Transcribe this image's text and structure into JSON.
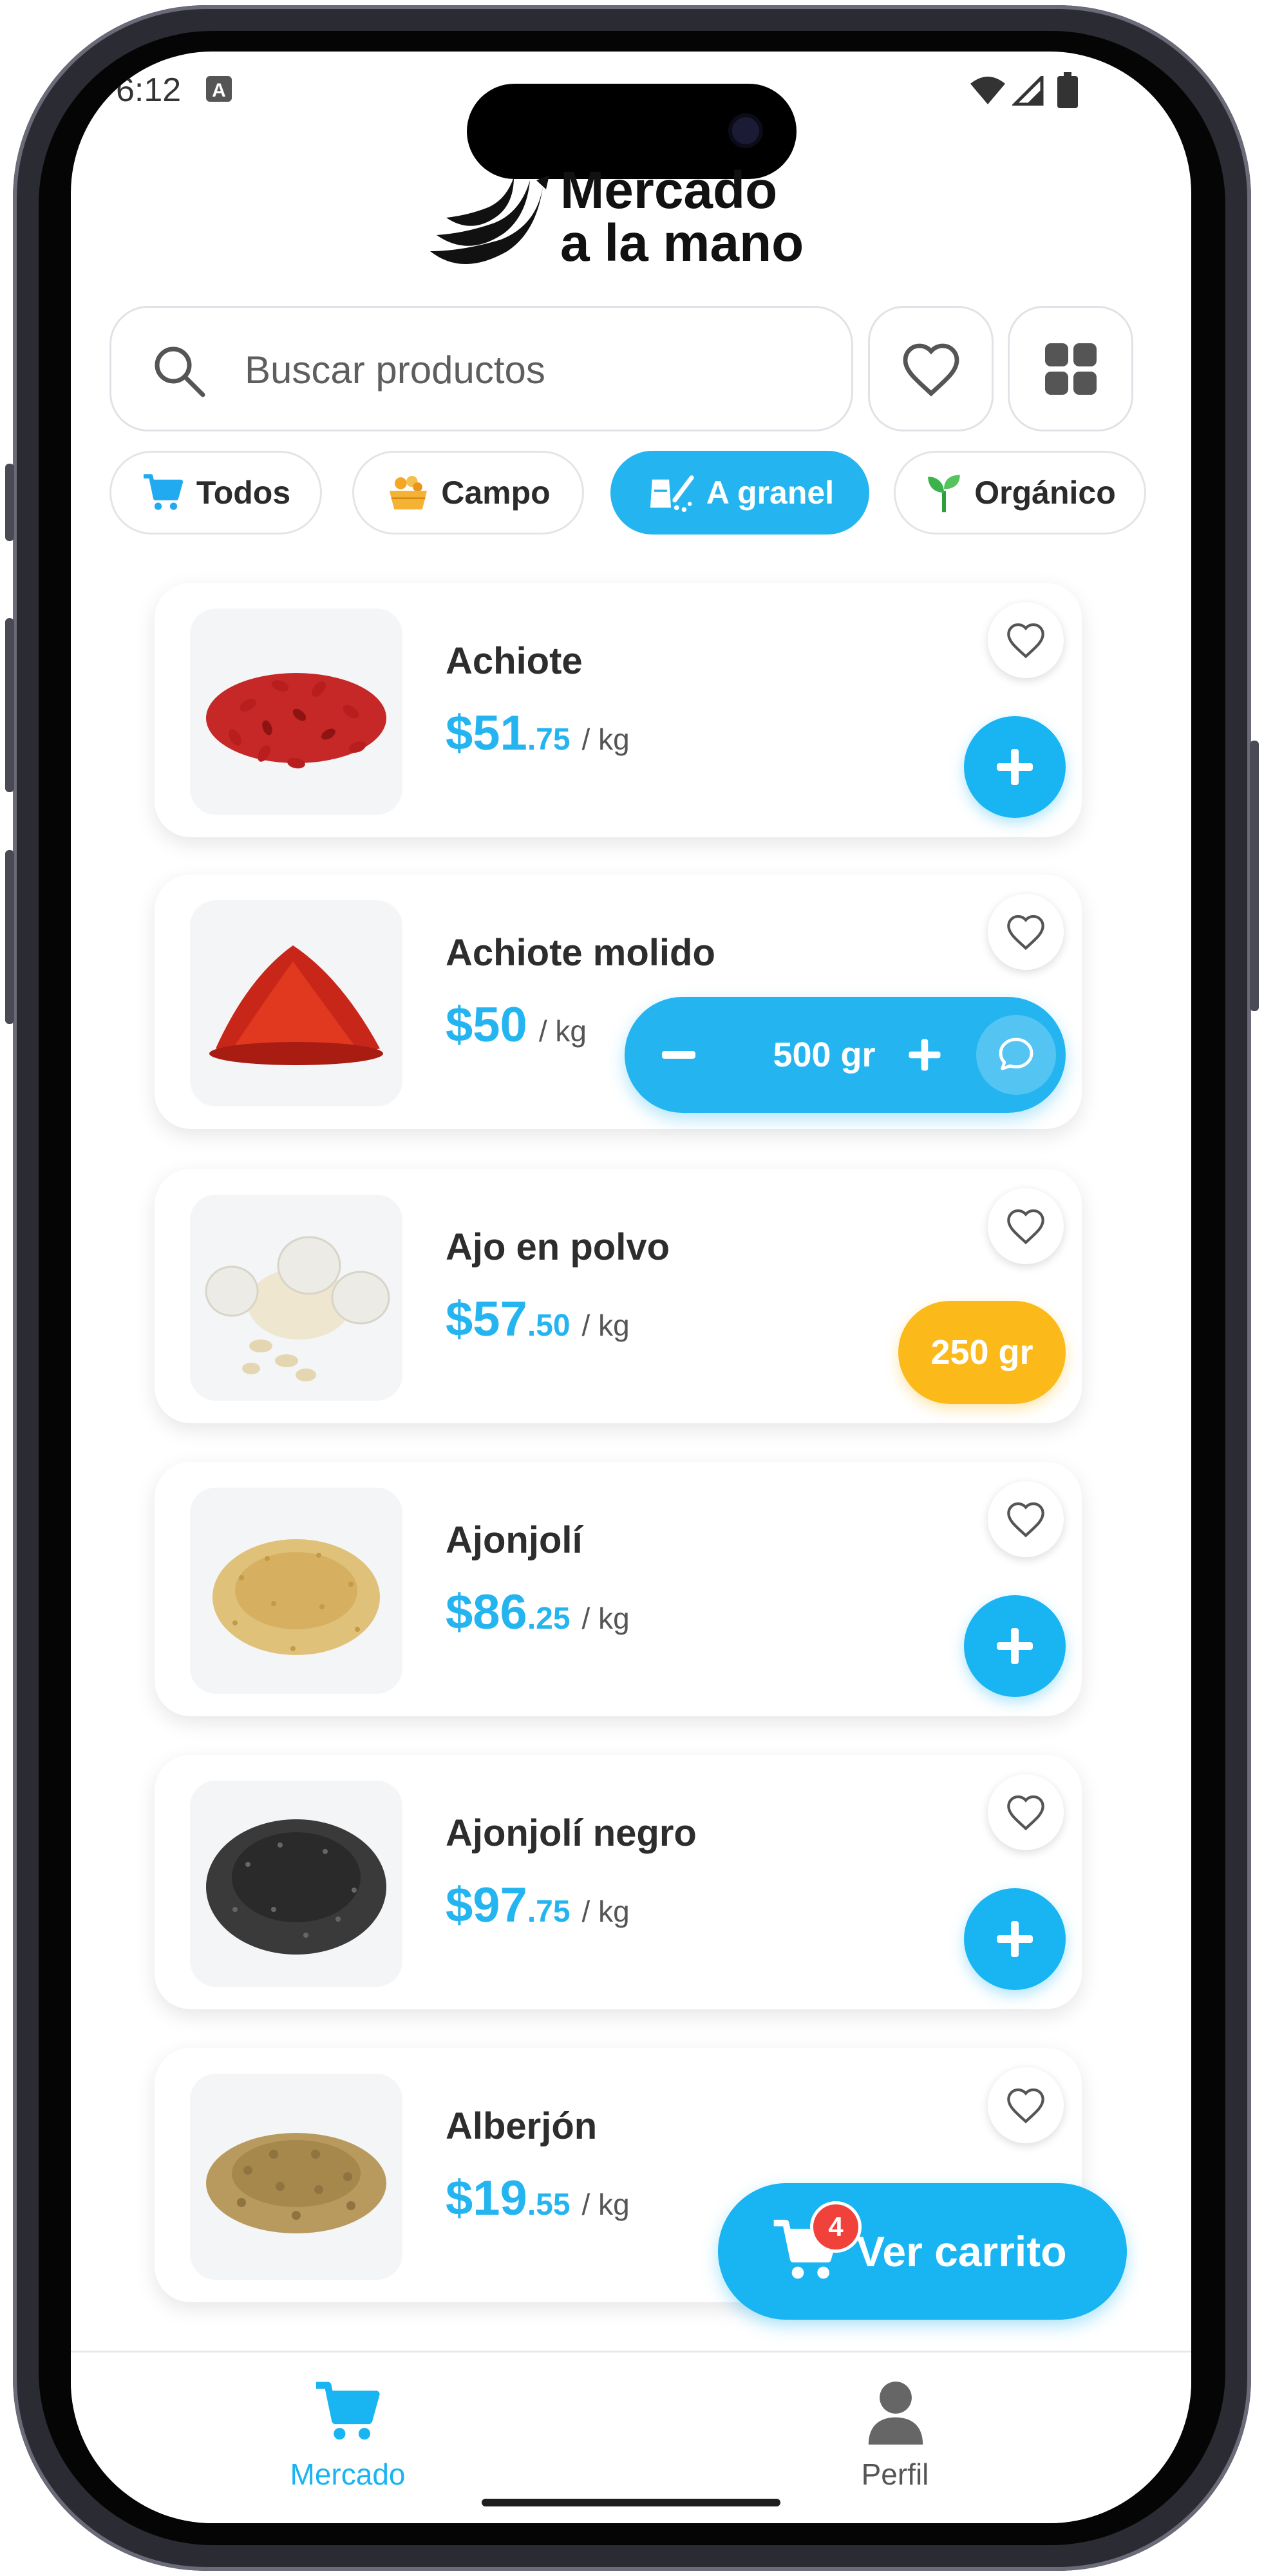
{
  "status_bar": {
    "time": "6:12"
  },
  "brand": {
    "line1": "Mercado",
    "line2": "a la mano"
  },
  "search": {
    "placeholder": "Buscar productos"
  },
  "toolbar": {
    "favorites_icon": "heart-icon",
    "grid_icon": "grid-icon"
  },
  "categories": [
    {
      "label": "Todos",
      "icon": "cart-icon",
      "active": false
    },
    {
      "label": "Campo",
      "icon": "basket-icon",
      "active": false
    },
    {
      "label": "A granel",
      "icon": "bulk-icon",
      "active": true
    },
    {
      "label": "Orgánico",
      "icon": "sprout-icon",
      "active": false
    }
  ],
  "products": [
    {
      "name": "Achiote",
      "price_whole": "$51",
      "price_cents": ".75",
      "unit": "/ kg",
      "action": "add"
    },
    {
      "name": "Achiote molido",
      "price_whole": "$50",
      "price_cents": "",
      "unit": "/ kg",
      "action": "stepper",
      "quantity": "500 gr"
    },
    {
      "name": "Ajo en polvo",
      "price_whole": "$57",
      "price_cents": ".50",
      "unit": "/ kg",
      "action": "quantity",
      "quantity": "250 gr"
    },
    {
      "name": "Ajonjolí",
      "price_whole": "$86",
      "price_cents": ".25",
      "unit": "/ kg",
      "action": "add"
    },
    {
      "name": "Ajonjolí negro",
      "price_whole": "$97",
      "price_cents": ".75",
      "unit": "/ kg",
      "action": "add"
    },
    {
      "name": "Alberjón",
      "price_whole": "$19",
      "price_cents": ".55",
      "unit": "/ kg",
      "action": "none"
    }
  ],
  "cart": {
    "label": "Ver carrito",
    "count": "4"
  },
  "bottom_nav": [
    {
      "label": "Mercado",
      "icon": "cart-icon",
      "active": true
    },
    {
      "label": "Perfil",
      "icon": "person-icon",
      "active": false
    }
  ],
  "colors": {
    "accent": "#24b5f0",
    "amber": "#fbb91a",
    "badge": "#f0413a"
  }
}
